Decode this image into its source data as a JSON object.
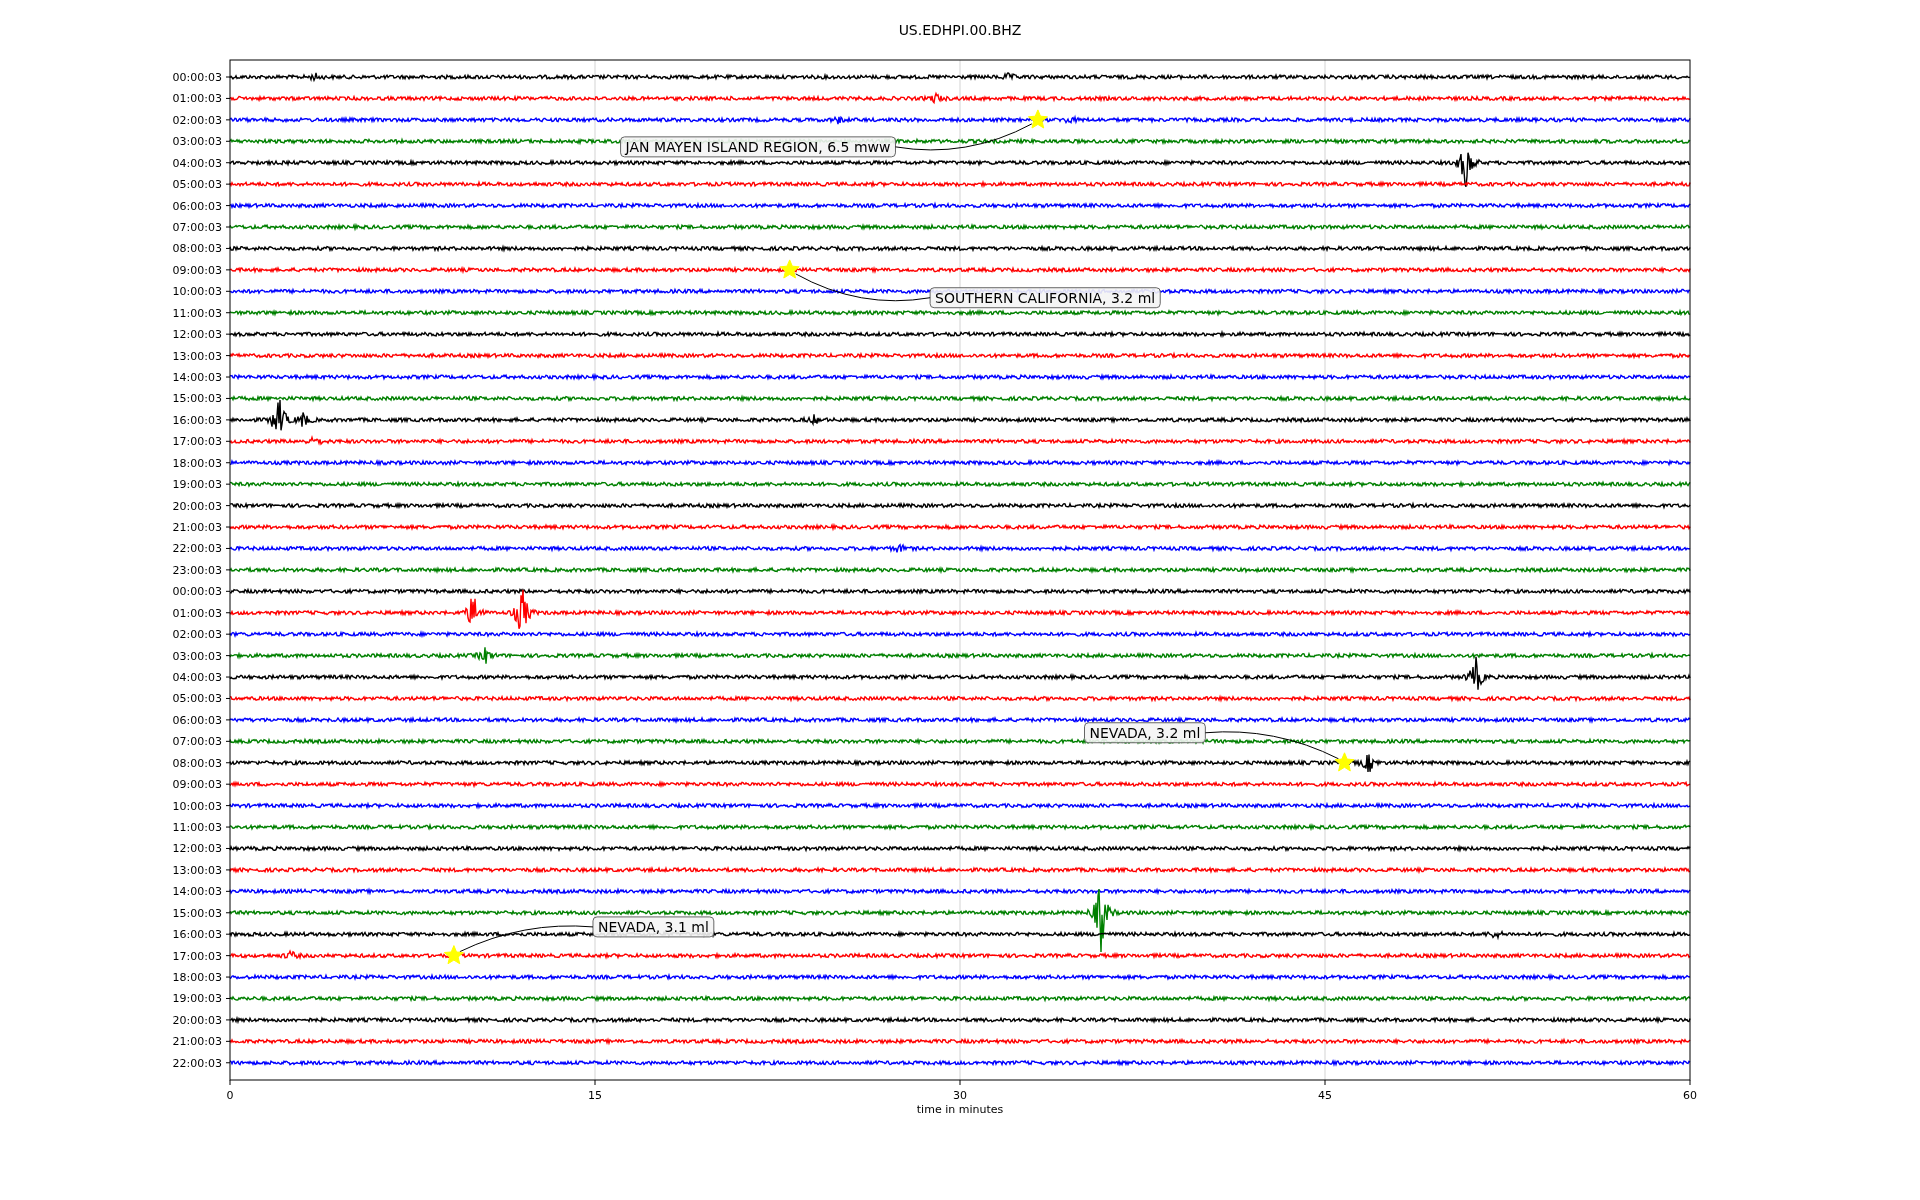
{
  "title": "US.EDHPI.00.BHZ",
  "seismogram": {
    "xlabel": "time in minutes",
    "x_tick_labels": [
      "0",
      "15",
      "30",
      "45",
      "60"
    ],
    "rows": [
      {
        "label": "00:00:03",
        "color": "#000000"
      },
      {
        "label": "01:00:03",
        "color": "#ff0000"
      },
      {
        "label": "02:00:03",
        "color": "#0000ff"
      },
      {
        "label": "03:00:03",
        "color": "#008000"
      },
      {
        "label": "04:00:03",
        "color": "#000000"
      },
      {
        "label": "05:00:03",
        "color": "#ff0000"
      },
      {
        "label": "06:00:03",
        "color": "#0000ff"
      },
      {
        "label": "07:00:03",
        "color": "#008000"
      },
      {
        "label": "08:00:03",
        "color": "#000000"
      },
      {
        "label": "09:00:03",
        "color": "#ff0000"
      },
      {
        "label": "10:00:03",
        "color": "#0000ff"
      },
      {
        "label": "11:00:03",
        "color": "#008000"
      },
      {
        "label": "12:00:03",
        "color": "#000000"
      },
      {
        "label": "13:00:03",
        "color": "#ff0000"
      },
      {
        "label": "14:00:03",
        "color": "#0000ff"
      },
      {
        "label": "15:00:03",
        "color": "#008000"
      },
      {
        "label": "16:00:03",
        "color": "#000000"
      },
      {
        "label": "17:00:03",
        "color": "#ff0000"
      },
      {
        "label": "18:00:03",
        "color": "#0000ff"
      },
      {
        "label": "19:00:03",
        "color": "#008000"
      },
      {
        "label": "20:00:03",
        "color": "#000000"
      },
      {
        "label": "21:00:03",
        "color": "#ff0000"
      },
      {
        "label": "22:00:03",
        "color": "#0000ff"
      },
      {
        "label": "23:00:03",
        "color": "#008000"
      },
      {
        "label": "00:00:03",
        "color": "#000000"
      },
      {
        "label": "01:00:03",
        "color": "#ff0000"
      },
      {
        "label": "02:00:03",
        "color": "#0000ff"
      },
      {
        "label": "03:00:03",
        "color": "#008000"
      },
      {
        "label": "04:00:03",
        "color": "#000000"
      },
      {
        "label": "05:00:03",
        "color": "#ff0000"
      },
      {
        "label": "06:00:03",
        "color": "#0000ff"
      },
      {
        "label": "07:00:03",
        "color": "#008000"
      },
      {
        "label": "08:00:03",
        "color": "#000000"
      },
      {
        "label": "09:00:03",
        "color": "#ff0000"
      },
      {
        "label": "10:00:03",
        "color": "#0000ff"
      },
      {
        "label": "11:00:03",
        "color": "#008000"
      },
      {
        "label": "12:00:03",
        "color": "#000000"
      },
      {
        "label": "13:00:03",
        "color": "#ff0000"
      },
      {
        "label": "14:00:03",
        "color": "#0000ff"
      },
      {
        "label": "15:00:03",
        "color": "#008000"
      },
      {
        "label": "16:00:03",
        "color": "#000000"
      },
      {
        "label": "17:00:03",
        "color": "#ff0000"
      },
      {
        "label": "18:00:03",
        "color": "#0000ff"
      },
      {
        "label": "19:00:03",
        "color": "#008000"
      },
      {
        "label": "20:00:03",
        "color": "#000000"
      },
      {
        "label": "21:00:03",
        "color": "#ff0000"
      },
      {
        "label": "22:00:03",
        "color": "#0000ff"
      }
    ],
    "annotations": [
      {
        "text": "JAN MAYEN ISLAND REGION, 6.5 mww"
      },
      {
        "text": "SOUTHERN CALIFORNIA, 3.2 ml"
      },
      {
        "text": "NEVADA, 3.2 ml"
      },
      {
        "text": "NEVADA, 3.1 ml"
      }
    ]
  }
}
